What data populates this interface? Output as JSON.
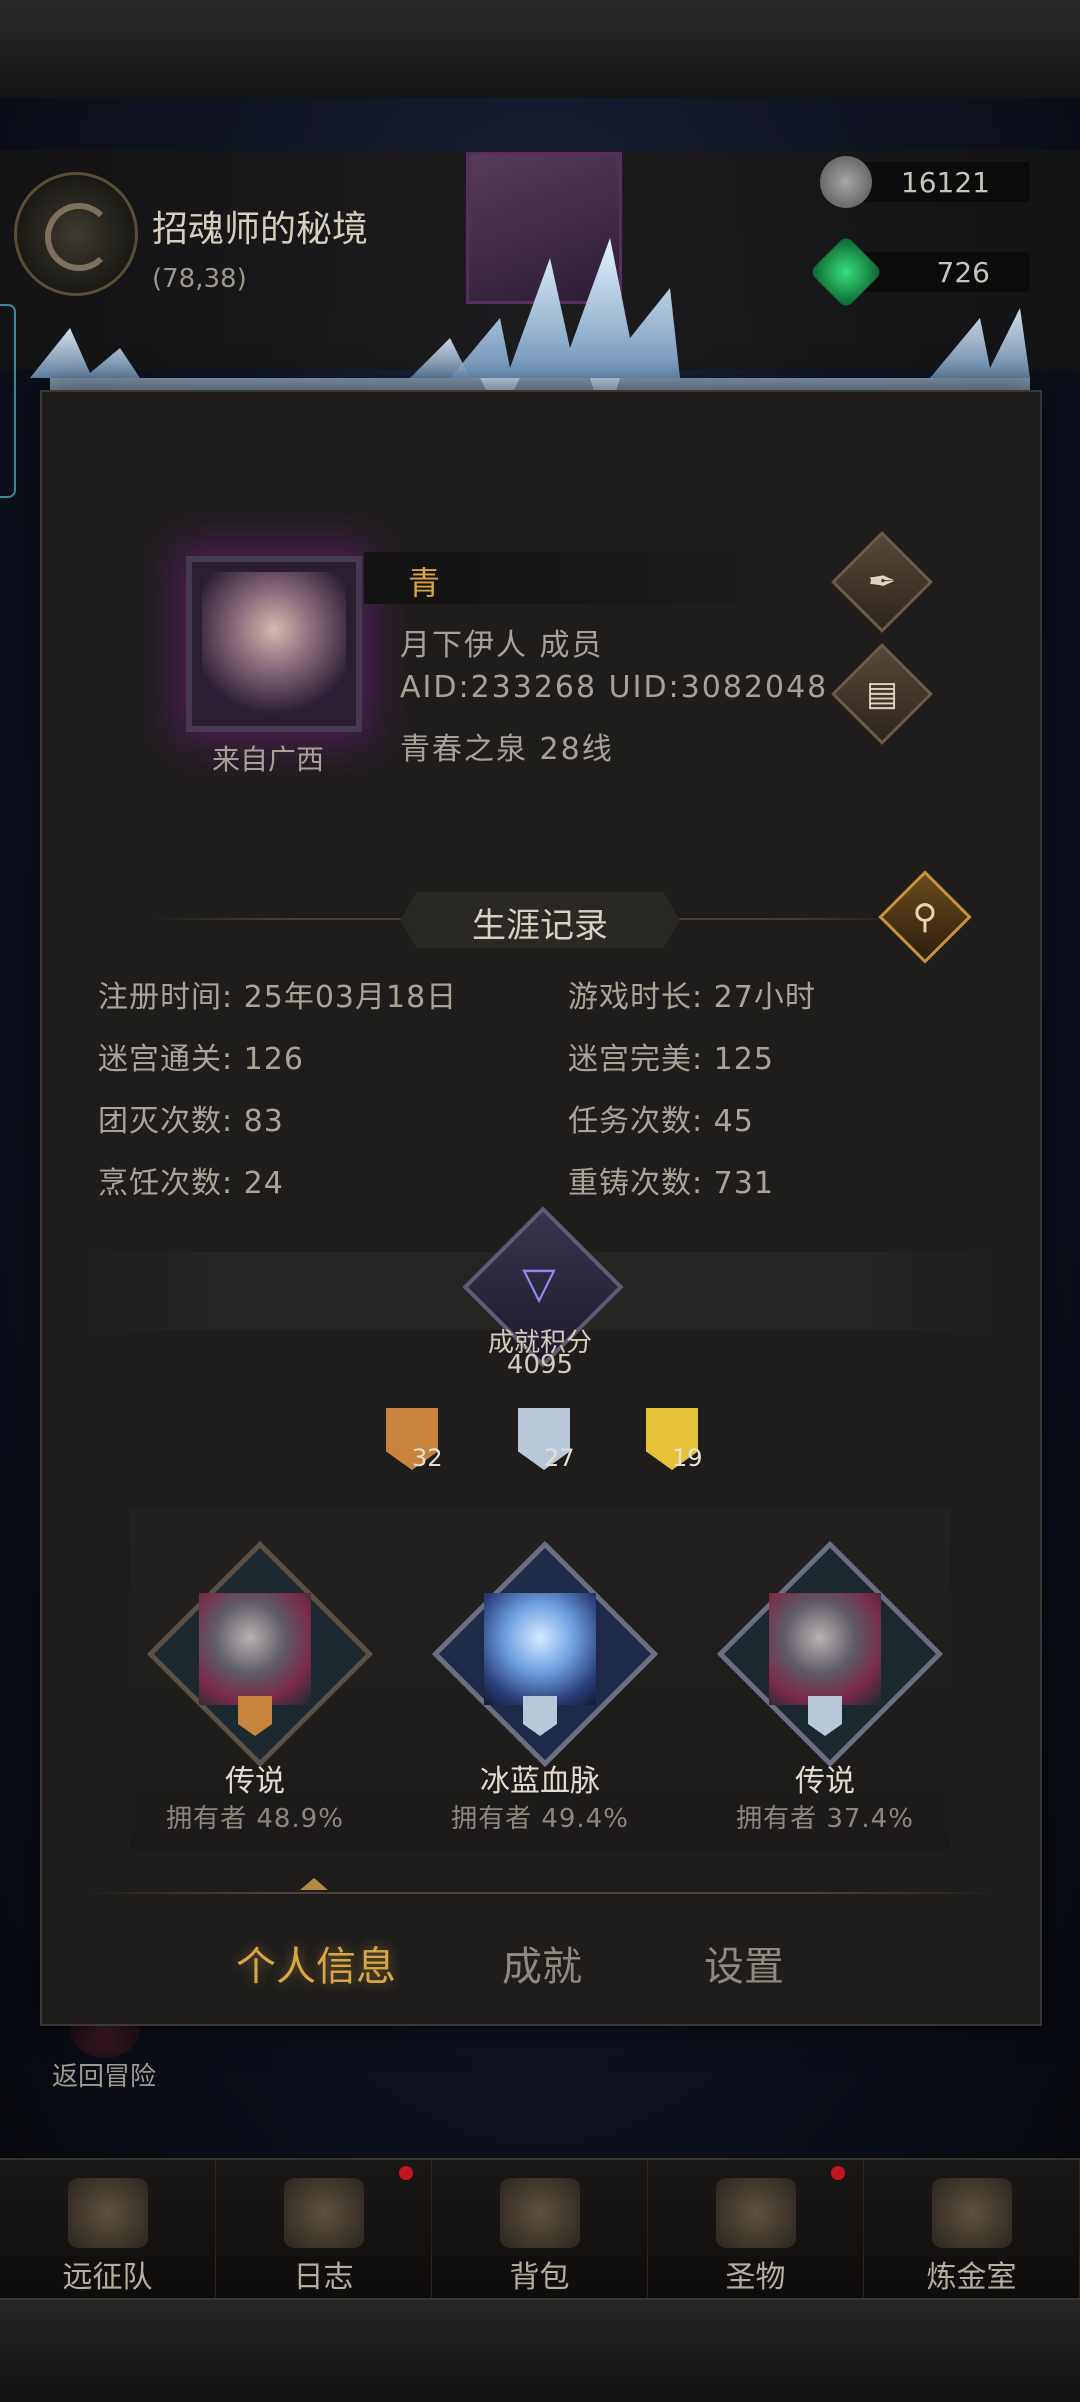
{
  "background": {
    "map_title": "招魂师的秘境",
    "map_coords": "(78,38)",
    "resources": [
      {
        "icon": "stone-icon",
        "value": "16121"
      },
      {
        "icon": "gem-icon",
        "value": "726"
      }
    ],
    "return_label": "返回冒险"
  },
  "profile": {
    "name": "青",
    "guild_line": "月下伊人  成员",
    "ids_line": "AID:233268 UID:3082048",
    "server_line": "青春之泉  28线",
    "hometown": "来自广西"
  },
  "career": {
    "title": "生涯记录",
    "stats": [
      {
        "label": "注册时间:",
        "value": "25年03月18日"
      },
      {
        "label": "游戏时长:",
        "value": "27小时"
      },
      {
        "label": "迷宫通关:",
        "value": "126"
      },
      {
        "label": "迷宫完美:",
        "value": "125"
      },
      {
        "label": "团灭次数:",
        "value": "83"
      },
      {
        "label": "任务次数:",
        "value": "45"
      },
      {
        "label": "烹饪次数:",
        "value": "24"
      },
      {
        "label": "重铸次数:",
        "value": "731"
      }
    ]
  },
  "achievements": {
    "label": "成就积分",
    "score": "4095",
    "medals": [
      {
        "tier": "bronze",
        "count": "32",
        "color": "#c8843c"
      },
      {
        "tier": "silver",
        "count": "27",
        "color": "#b8c8d8"
      },
      {
        "tier": "gold",
        "count": "19",
        "color": "#e6c13a"
      }
    ],
    "cards": [
      {
        "name": "传说",
        "owners": "拥有者 48.9%"
      },
      {
        "name": "冰蓝血脉",
        "owners": "拥有者 49.4%"
      },
      {
        "name": "传说",
        "owners": "拥有者 37.4%"
      }
    ]
  },
  "tabs": [
    {
      "label": "个人信息",
      "active": true
    },
    {
      "label": "成就",
      "active": false
    },
    {
      "label": "设置",
      "active": false
    }
  ],
  "bottom_nav": [
    {
      "label": "远征队",
      "icon": "helmet-icon",
      "badge": false
    },
    {
      "label": "日志",
      "icon": "map-scroll-icon",
      "badge": true
    },
    {
      "label": "背包",
      "icon": "backpack-icon",
      "badge": false
    },
    {
      "label": "圣物",
      "icon": "relic-icon",
      "badge": true
    },
    {
      "label": "炼金室",
      "icon": "alchemy-icon",
      "badge": false
    }
  ],
  "colors": {
    "accent_gold": "#d9a545",
    "badge_red": "#c0151d",
    "panel_bg": "#1e1d1c"
  }
}
